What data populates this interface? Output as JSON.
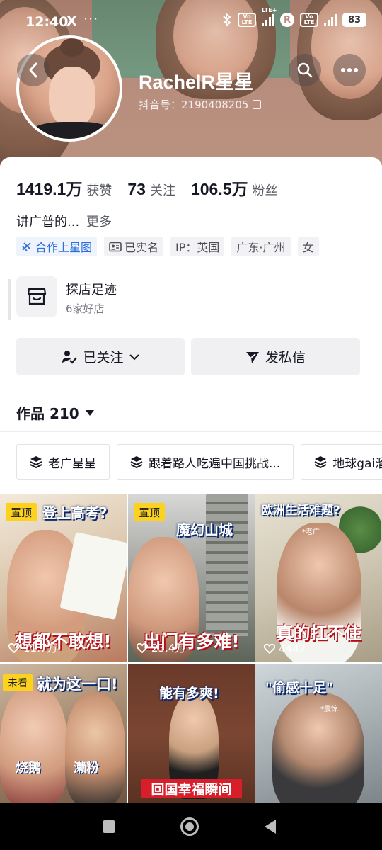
{
  "status_bar": {
    "time": "12:40",
    "x_icon": "X",
    "more_dots": "···",
    "volte_1": "Vo LTE",
    "lte_tag": "LTE+",
    "r_icon": "R",
    "volte_2": "Vo LTE",
    "battery": "83"
  },
  "profile": {
    "username": "RachelR星星",
    "douyin_id": "抖音号：2190408205",
    "avatar_icon": "avatar-photo"
  },
  "stats": [
    {
      "value": "1419.1万",
      "label": "获赞"
    },
    {
      "value": "73",
      "label": "关注"
    },
    {
      "value": "106.5万",
      "label": "粉丝"
    }
  ],
  "bio": {
    "text": "讲广普的...",
    "more": "更多"
  },
  "tags": [
    {
      "label": "合作上星图",
      "icon": "star-map-icon",
      "style": "blue"
    },
    {
      "label": "已实名",
      "icon": "id-card-icon",
      "style": "gray"
    },
    {
      "label": "IP：英国",
      "icon": "",
      "style": "gray"
    },
    {
      "label": "广东·广州",
      "icon": "",
      "style": "gray"
    },
    {
      "label": "女",
      "icon": "",
      "style": "gray"
    }
  ],
  "shop": {
    "title": "探店足迹",
    "subtitle": "6家好店"
  },
  "buttons": {
    "followed": "已关注",
    "message": "发私信"
  },
  "works": {
    "label": "作品 210"
  },
  "chips": [
    {
      "label": "老广星星"
    },
    {
      "label": "跟着路人吃遍中国挑战..."
    },
    {
      "label": "地球gai溜"
    }
  ],
  "videos": [
    {
      "pin": "置顶",
      "top_text": "登上高考?",
      "bottom_text": "想都不敢想!",
      "likes": "11.7万"
    },
    {
      "pin": "置顶",
      "top_text": "魔幻山城",
      "bottom_text": "出门有多难!",
      "likes": "23.4万"
    },
    {
      "pin": "",
      "top_text": "欧洲生活难题?",
      "bottom_text": "真的扛不住",
      "likes": "4442",
      "small_label": "*老广"
    },
    {
      "pin": "未看",
      "top_text": "就为这一口!",
      "bottom_text": "",
      "likes": "",
      "left_label": "烧鹅",
      "right_label": "濑粉"
    },
    {
      "pin": "",
      "top_text": "能有多爽!",
      "bottom_text": "回国幸福瞬间",
      "likes": ""
    },
    {
      "pin": "",
      "top_text": "\"偷感十足\"",
      "bottom_text": "",
      "likes": "",
      "small_label": "*震惊"
    }
  ],
  "colors": {
    "accent_blue": "#2f6fd8",
    "pin_yellow": "#fdd21f",
    "text_primary": "#161823",
    "text_secondary": "#5a5d66"
  }
}
